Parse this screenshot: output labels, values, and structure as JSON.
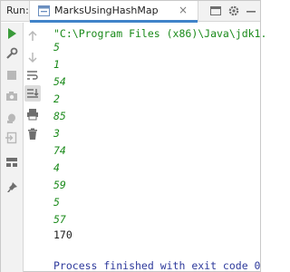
{
  "header": {
    "run_label": "Run:",
    "tab_label": "MarksUsingHashMap",
    "tab_close": "×"
  },
  "console": {
    "command": "\"C:\\Program Files (x86)\\Java\\jdk1.",
    "output_lines": [
      "5",
      "1",
      "54",
      "2",
      "85",
      "3",
      "74",
      "4",
      "59",
      "5",
      "57"
    ],
    "total": "170",
    "process_message": "Process finished with exit code 0"
  },
  "colors": {
    "green_text": "#1a8a1a",
    "process_text": "#2e3a9c",
    "accent": "#4083c9"
  }
}
